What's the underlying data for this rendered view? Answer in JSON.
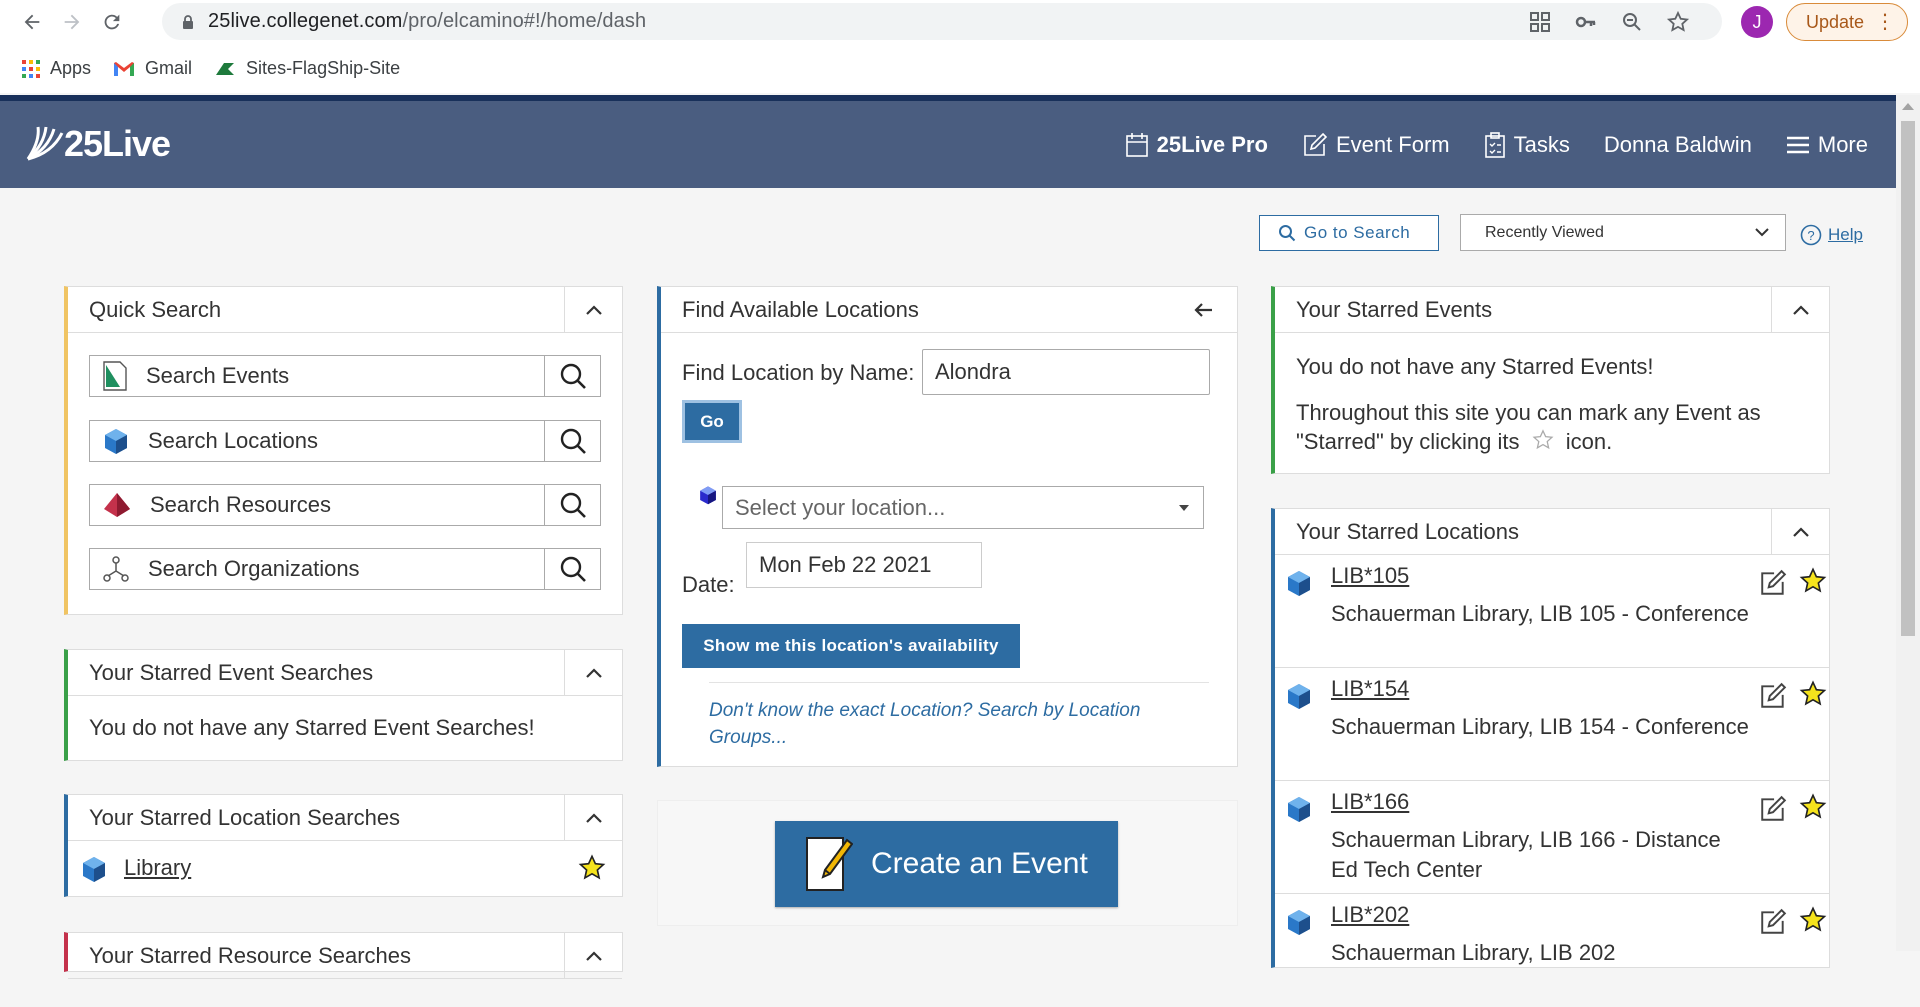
{
  "browser": {
    "url_host": "25live.collegenet.com",
    "url_path": "/pro/elcamino#!/home/dash",
    "profile_initial": "J",
    "update_label": "Update",
    "bookmarks": [
      {
        "label": "Apps"
      },
      {
        "label": "Gmail"
      },
      {
        "label": "Sites-FlagShip-Site"
      }
    ]
  },
  "header": {
    "logo_text": "25Live",
    "nav": {
      "pro": "25Live Pro",
      "event_form": "Event Form",
      "tasks": "Tasks",
      "user": "Donna Baldwin",
      "more": "More"
    }
  },
  "toolbar": {
    "go_to_search": "Go to Search",
    "recently_viewed": "Recently Viewed",
    "help": "Help"
  },
  "quick_search": {
    "title": "Quick Search",
    "items": [
      {
        "label": "Search Events",
        "icon": "event-icon"
      },
      {
        "label": "Search Locations",
        "icon": "location-cube-icon"
      },
      {
        "label": "Search Resources",
        "icon": "resource-icon"
      },
      {
        "label": "Search Organizations",
        "icon": "organization-icon"
      }
    ]
  },
  "starred_event_searches": {
    "title": "Your Starred Event Searches",
    "message": "You do not have any Starred Event Searches!"
  },
  "starred_location_searches": {
    "title": "Your Starred Location Searches",
    "items": [
      {
        "label": "Library"
      }
    ]
  },
  "starred_resource_searches": {
    "title": "Your Starred Resource Searches"
  },
  "find_locations": {
    "title": "Find Available Locations",
    "name_label": "Find Location by Name:",
    "name_value": "Alondra",
    "go_label": "Go",
    "select_placeholder": "Select your location...",
    "date_label": "Date:",
    "date_value": "Mon Feb 22 2021",
    "availability_button": "Show me this location's availability",
    "groups_link": "Don't know the exact Location? Search by Location Groups..."
  },
  "create_event": {
    "label": "Create an Event"
  },
  "starred_events": {
    "title": "Your Starred Events",
    "message1": "You do not have any Starred Events!",
    "message2_before": "Throughout this site you can mark any Event as \"Starred\" by clicking its",
    "message2_after": "icon."
  },
  "starred_locations": {
    "title": "Your Starred Locations",
    "items": [
      {
        "name": "LIB*105",
        "desc": "Schauerman Library, LIB 105 - Conference"
      },
      {
        "name": "LIB*154",
        "desc": "Schauerman Library, LIB 154 - Conference"
      },
      {
        "name": "LIB*166",
        "desc": "Schauerman Library, LIB 166 - Distance Ed Tech Center"
      },
      {
        "name": "LIB*202",
        "desc": "Schauerman Library, LIB 202"
      }
    ]
  },
  "colors": {
    "header_bg": "#4a5d80",
    "header_border": "#18305a",
    "primary": "#2d6ca2",
    "quick_search_accent": "#f0c463",
    "green_accent": "#3aa048",
    "blue_accent": "#2d6ca2",
    "red_accent": "#c4314b"
  }
}
